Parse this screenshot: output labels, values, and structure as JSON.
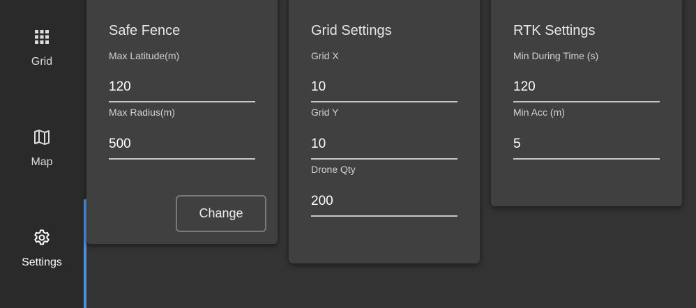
{
  "sidebar": {
    "items": [
      {
        "label": "Grid",
        "icon": "grid-icon",
        "active": false
      },
      {
        "label": "Map",
        "icon": "map-icon",
        "active": false
      },
      {
        "label": "Settings",
        "icon": "gear-icon",
        "active": true
      }
    ],
    "active_color": "#4a90e2"
  },
  "safe_fence": {
    "title": "Safe Fence",
    "max_latitude_label": "Max Latitude(m)",
    "max_latitude_value": "120",
    "max_radius_label": "Max Radius(m)",
    "max_radius_value": "500",
    "change_label": "Change"
  },
  "grid_settings": {
    "title": "Grid Settings",
    "grid_x_label": "Grid X",
    "grid_x_value": "10",
    "grid_y_label": "Grid Y",
    "grid_y_value": "10",
    "drone_qty_label": "Drone Qty",
    "drone_qty_value": "200"
  },
  "rtk_settings": {
    "title": "RTK Settings",
    "min_during_time_label": "Min During Time (s)",
    "min_during_time_value": "120",
    "min_acc_label": "Min Acc (m)",
    "min_acc_value": "5"
  }
}
